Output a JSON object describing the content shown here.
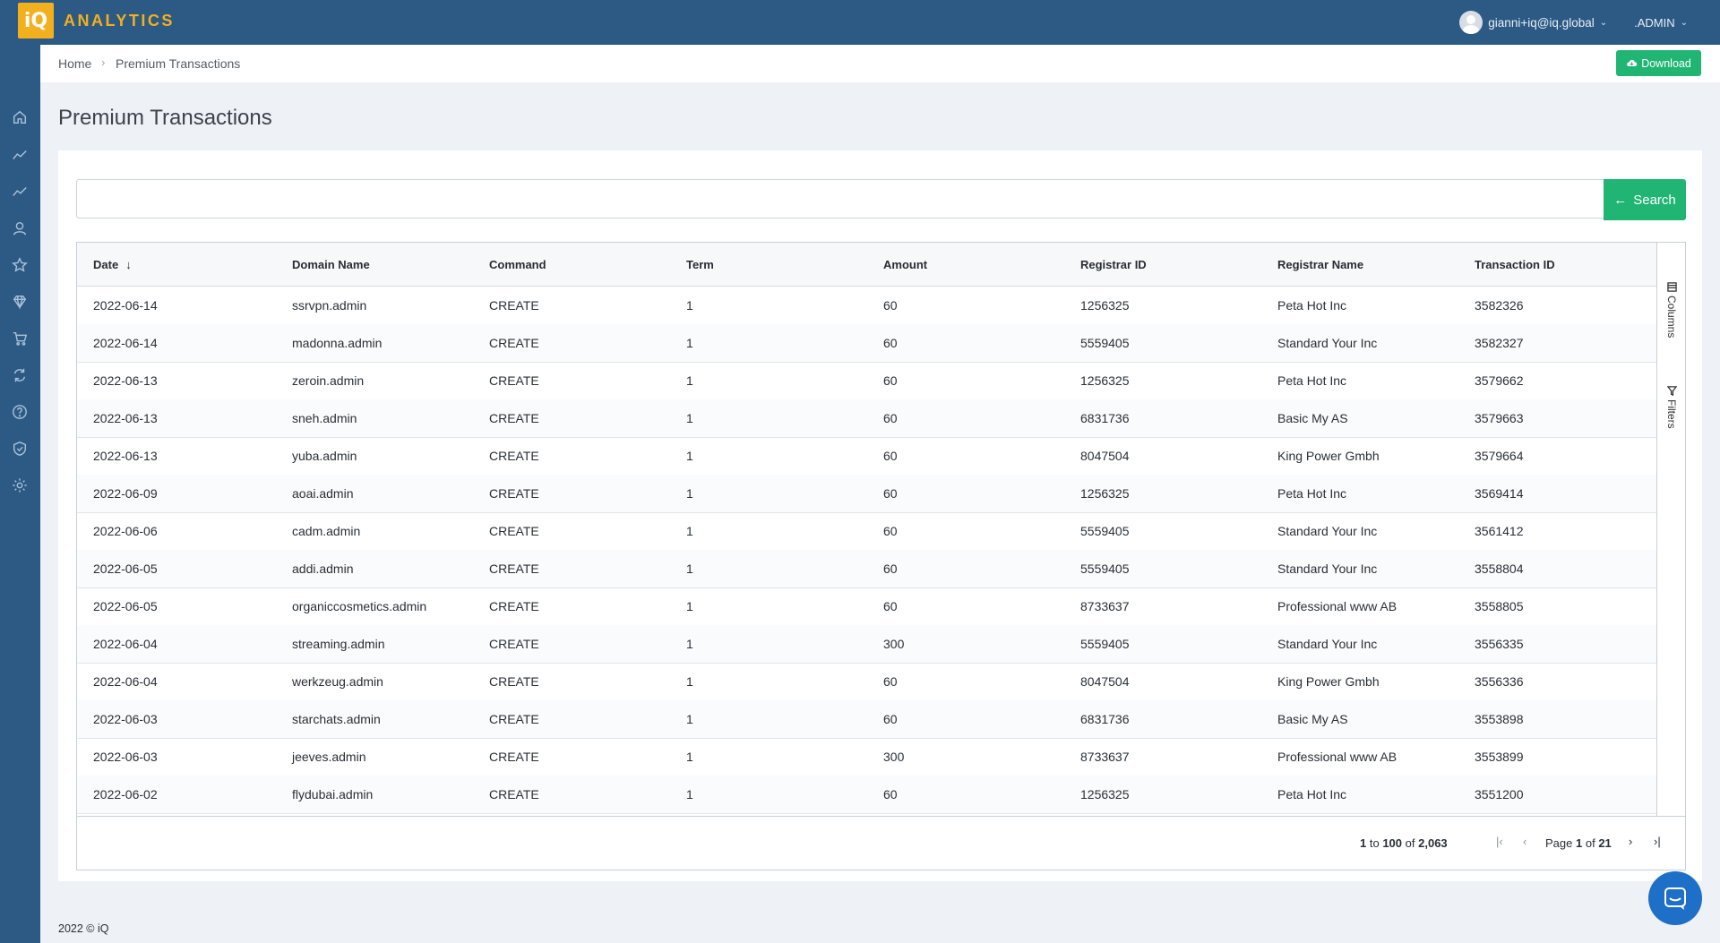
{
  "app": {
    "logo_letters": "iQ",
    "logo_text": "ANALYTICS",
    "user_email": "gianni+iq@iq.global",
    "role": ".ADMIN"
  },
  "breadcrumb": {
    "home": "Home",
    "current": "Premium Transactions"
  },
  "toolbar": {
    "download_label": "Download"
  },
  "page": {
    "title": "Premium Transactions"
  },
  "search": {
    "value": "",
    "placeholder": "",
    "button_label": "Search"
  },
  "table": {
    "columns": [
      "Date",
      "Domain Name",
      "Command",
      "Term",
      "Amount",
      "Registrar ID",
      "Registrar Name",
      "Transaction ID"
    ],
    "rows": [
      [
        "2022-06-14",
        "ssrvpn.admin",
        "CREATE",
        "1",
        "60",
        "1256325",
        "Peta Hot Inc",
        "3582326"
      ],
      [
        "2022-06-14",
        "madonna.admin",
        "CREATE",
        "1",
        "60",
        "5559405",
        "Standard Your Inc",
        "3582327"
      ],
      [
        "2022-06-13",
        "zeroin.admin",
        "CREATE",
        "1",
        "60",
        "1256325",
        "Peta Hot Inc",
        "3579662"
      ],
      [
        "2022-06-13",
        "sneh.admin",
        "CREATE",
        "1",
        "60",
        "6831736",
        "Basic My AS",
        "3579663"
      ],
      [
        "2022-06-13",
        "yuba.admin",
        "CREATE",
        "1",
        "60",
        "8047504",
        "King Power Gmbh",
        "3579664"
      ],
      [
        "2022-06-09",
        "aoai.admin",
        "CREATE",
        "1",
        "60",
        "1256325",
        "Peta Hot Inc",
        "3569414"
      ],
      [
        "2022-06-06",
        "cadm.admin",
        "CREATE",
        "1",
        "60",
        "5559405",
        "Standard Your Inc",
        "3561412"
      ],
      [
        "2022-06-05",
        "addi.admin",
        "CREATE",
        "1",
        "60",
        "5559405",
        "Standard Your Inc",
        "3558804"
      ],
      [
        "2022-06-05",
        "organiccosmetics.admin",
        "CREATE",
        "1",
        "60",
        "8733637",
        "Professional www AB",
        "3558805"
      ],
      [
        "2022-06-04",
        "streaming.admin",
        "CREATE",
        "1",
        "300",
        "5559405",
        "Standard Your Inc",
        "3556335"
      ],
      [
        "2022-06-04",
        "werkzeug.admin",
        "CREATE",
        "1",
        "60",
        "8047504",
        "King Power Gmbh",
        "3556336"
      ],
      [
        "2022-06-03",
        "starchats.admin",
        "CREATE",
        "1",
        "60",
        "6831736",
        "Basic My AS",
        "3553898"
      ],
      [
        "2022-06-03",
        "jeeves.admin",
        "CREATE",
        "1",
        "300",
        "8733637",
        "Professional www AB",
        "3553899"
      ],
      [
        "2022-06-02",
        "flydubai.admin",
        "CREATE",
        "1",
        "60",
        "1256325",
        "Peta Hot Inc",
        "3551200"
      ]
    ],
    "side_tabs": {
      "columns": "Columns",
      "filters": "Filters"
    }
  },
  "pager": {
    "from": "1",
    "to_word": "to",
    "to": "100",
    "of_word": "of",
    "total": "2,063",
    "page_word": "Page",
    "page": "1",
    "pages": "21"
  },
  "footer": {
    "copyright": "2022 © iQ"
  },
  "colors": {
    "header_bg": "#2c5a85",
    "accent_green": "#21b573",
    "logo_yellow": "#f2b01e",
    "chat_blue": "#1e6fc8"
  },
  "icons": {
    "sidebar": [
      "home-icon",
      "trend-icon",
      "trend-icon-2",
      "user-icon",
      "star-icon",
      "diamond-icon",
      "cart-icon",
      "refresh-icon",
      "help-icon",
      "shield-icon",
      "gear-icon"
    ]
  }
}
